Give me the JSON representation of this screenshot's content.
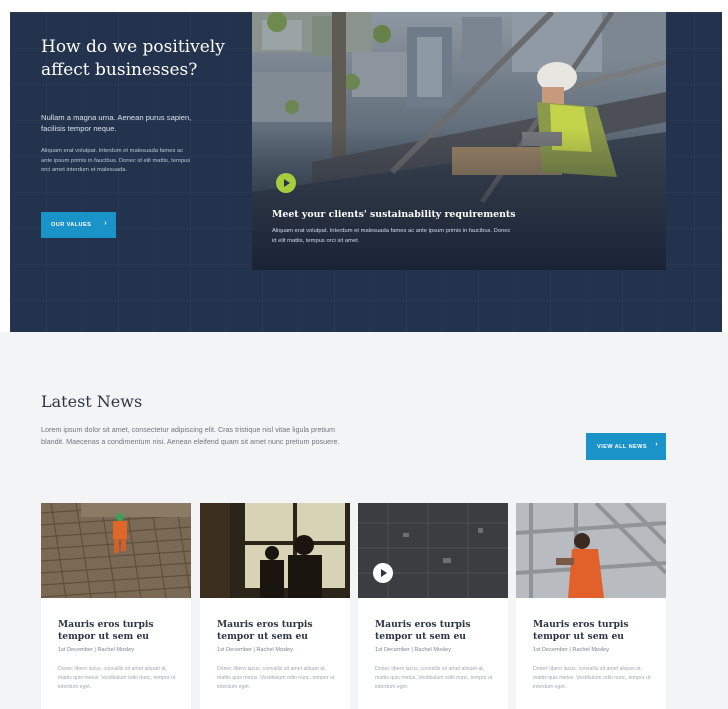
{
  "hero": {
    "title": "How do we positively affect businesses?",
    "intro": "Nullam a magna urna. Aenean purus sapien, facilisis tempor neque.",
    "body": "Aliquam erat volutpat. Interdum et malesuada fames ac ante ipsum primis in faucibus. Donec id elit mattis, tempus orci amet interdum et malesuada.",
    "button_label": "OUR VALUES",
    "button_icon": "chevron-right-icon",
    "background": "#23334d",
    "accent": "#1a93c9"
  },
  "video": {
    "play_icon": "play-icon",
    "play_color": "#a7cc3c",
    "title": "Meet your clients' sustainability requirements",
    "text": "Aliquam erat volutpat. Interdum et malesuada fames ac ante ipsum primis in faucibus. Donec id elit mattis, tempus orci sit amet."
  },
  "news": {
    "heading": "Latest News",
    "intro": "Lorem ipsum dolor sit amet, consectetur adipiscing elit. Cras tristique nisl vitae ligula pretium blandit. Maecenas a condimentum nisi. Aenean eleifend quam sit amet nunc pretium posuere.",
    "button_label": "VIEW ALL NEWS",
    "button_icon": "chevron-right-icon",
    "cards": [
      {
        "title": "Mauris eros turpis tempor ut sem eu",
        "meta": "1st December | Rachel Mosley",
        "text": "Donec libero lacus, convallis sit amet aliquet at, mattis quis metus. Vestibulum odio nunc, tempor ut interdum eget.",
        "has_play": false
      },
      {
        "title": "Mauris eros turpis tempor ut sem eu",
        "meta": "1st December | Rachel Mosley",
        "text": "Donec libero lacus, convallis sit amet aliquet at, mattis quis metus. Vestibulum odio nunc, tempor ut interdum eget.",
        "has_play": false
      },
      {
        "title": "Mauris eros turpis tempor ut sem eu",
        "meta": "1st December | Rachel Mosley",
        "text": "Donec libero lacus, convallis sit amet aliquet at, mattis quis metus. Vestibulum odio nunc, tempor ut interdum eget.",
        "has_play": true
      },
      {
        "title": "Mauris eros turpis tempor ut sem eu",
        "meta": "1st December | Rachel Mosley",
        "text": "Donec libero lacus, convallis sit amet aliquet at, mattis quis metus. Vestibulum odio nunc, tempor ut interdum eget.",
        "has_play": false
      }
    ]
  }
}
